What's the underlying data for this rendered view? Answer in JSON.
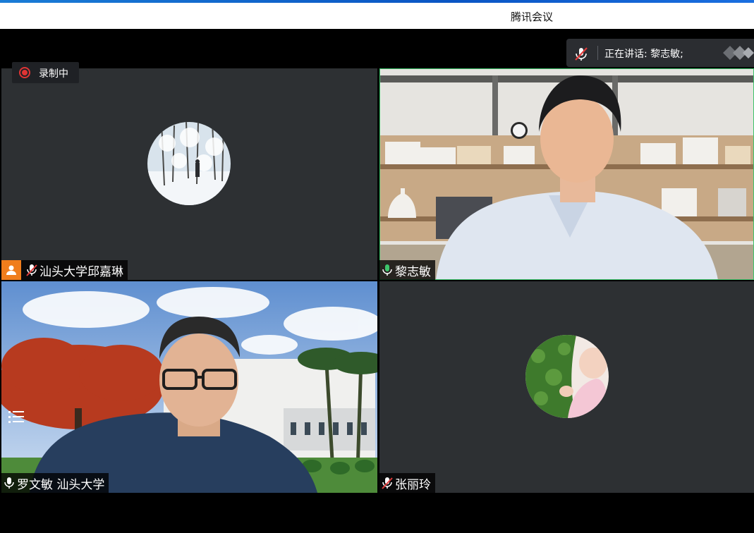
{
  "window": {
    "title": "腾讯会议"
  },
  "speaking": {
    "prefix": "正在讲话: ",
    "names": "黎志敏;"
  },
  "recording": {
    "label": "录制中"
  },
  "participants": [
    {
      "name": "汕头大学邱嘉琳",
      "mic": "muted",
      "video": "off",
      "avatar_icon": "snow-landscape-avatar",
      "host": true
    },
    {
      "name": "黎志敏",
      "mic": "on",
      "video": "on",
      "active_speaker": true
    },
    {
      "name": "罗文敏 汕头大学",
      "mic": "on",
      "video": "on"
    },
    {
      "name": "张丽玲",
      "mic": "muted",
      "video": "off",
      "avatar_icon": "baby-avatar"
    }
  ],
  "colors": {
    "accent": "#1a7cd6",
    "active_border": "#3ec46b",
    "recording": "#e03434",
    "host_badge": "#f07d1c"
  }
}
